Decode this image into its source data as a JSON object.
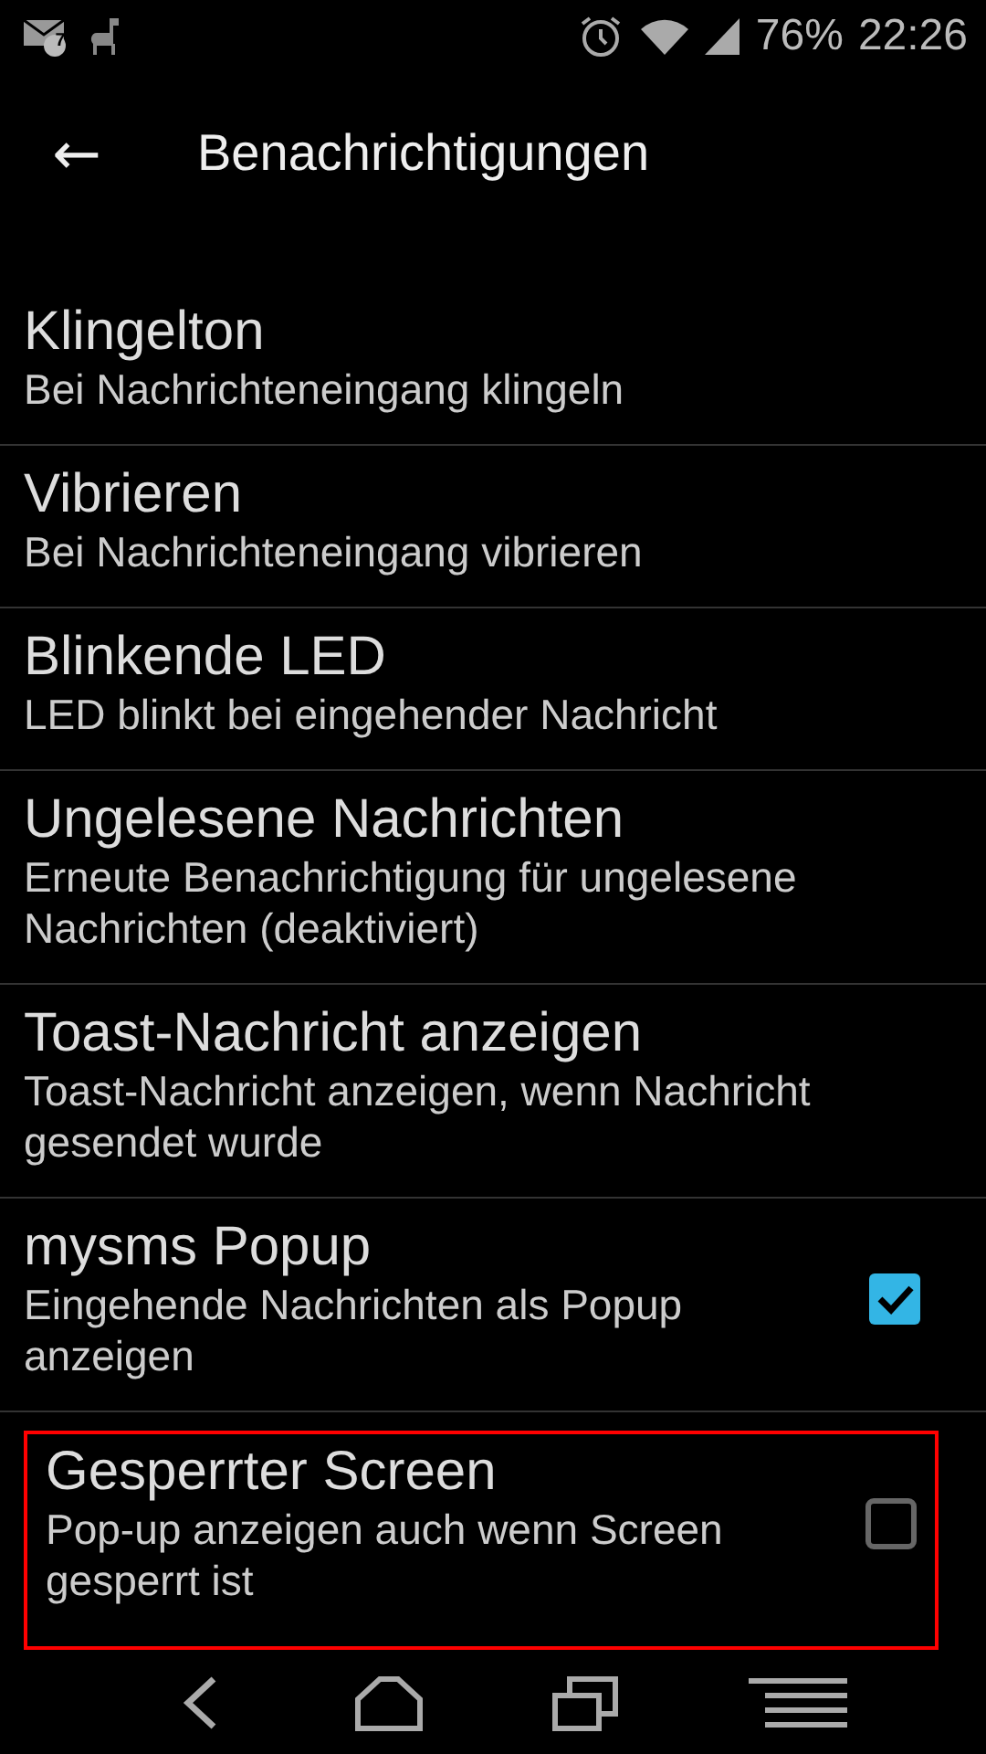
{
  "status_bar": {
    "battery": "76%",
    "time": "22:26",
    "mail_count": "7"
  },
  "app_bar": {
    "back": "←",
    "title": "Benachrichtigungen"
  },
  "items": [
    {
      "kind": "text",
      "title": "Klingelton",
      "summary": "Bei Nachrichteneingang klingeln",
      "highlighted": false
    },
    {
      "kind": "text",
      "title": "Vibrieren",
      "summary": "Bei Nachrichteneingang vibrieren",
      "highlighted": false
    },
    {
      "kind": "text",
      "title": "Blinkende LED",
      "summary": "LED blinkt bei eingehender Nachricht",
      "highlighted": false
    },
    {
      "kind": "text",
      "title": "Ungelesene Nachrichten",
      "summary": "Erneute Benachrichtigung für ungelesene Nachrichten (deaktiviert)",
      "highlighted": false
    },
    {
      "kind": "text",
      "title": "Toast-Nachricht anzeigen",
      "summary": "Toast-Nachricht anzeigen, wenn Nachricht gesendet wurde",
      "highlighted": false
    },
    {
      "kind": "checkbox",
      "title": "mysms Popup",
      "summary": "Eingehende Nachrichten als Popup anzeigen",
      "checked": true,
      "highlighted": false
    },
    {
      "kind": "checkbox",
      "title": "Gesperrter Screen",
      "summary": "Pop-up anzeigen auch wenn Screen gesperrt ist",
      "checked": false,
      "highlighted": true
    }
  ]
}
